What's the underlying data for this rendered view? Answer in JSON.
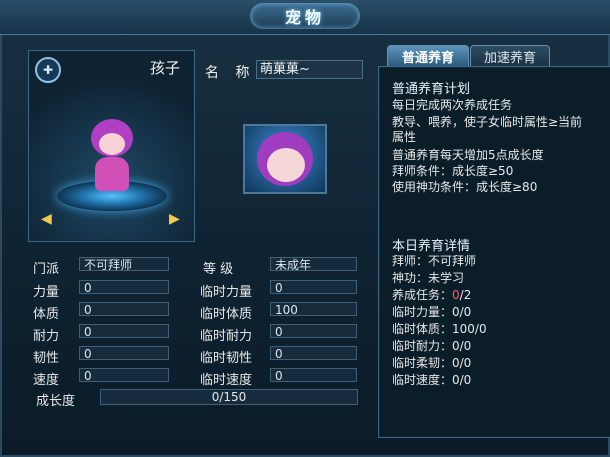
{
  "window": {
    "title": "宠物"
  },
  "pet": {
    "panel_label": "孩子",
    "name_label": "名 称",
    "name_value": "萌菓菓~"
  },
  "stats": {
    "sect_label": "门派",
    "sect_value": "不可拜师",
    "level_label": "等 级",
    "level_value": "未成年",
    "strength_label": "力量",
    "strength_value": "0",
    "temp_strength_label": "临时力量",
    "temp_strength_value": "0",
    "physique_label": "体质",
    "physique_value": "0",
    "temp_physique_label": "临时体质",
    "temp_physique_value": "100",
    "endurance_label": "耐力",
    "endurance_value": "0",
    "temp_endurance_label": "临时耐力",
    "temp_endurance_value": "0",
    "toughness_label": "韧性",
    "toughness_value": "0",
    "temp_toughness_label": "临时韧性",
    "temp_toughness_value": "0",
    "speed_label": "速度",
    "speed_value": "0",
    "temp_speed_label": "临时速度",
    "temp_speed_value": "0",
    "growth_label": "成长度",
    "growth_value": "0/150",
    "growth_progress": 0
  },
  "tabs": {
    "normal": "普通养育",
    "advanced": "加速养育"
  },
  "plan": {
    "title": "普通养育计划",
    "line1": "每日完成两次养成任务",
    "line2": "教导、喂养，使子女临时属性≥当前",
    "line3": "属性",
    "line4": "普通养育每天增加5点成长度",
    "line5": "拜师条件：成长度≥50",
    "line6": "使用神功条件：成长度≥80"
  },
  "details": {
    "title": "本日养育详情",
    "master": "拜师：不可拜师",
    "skill": "神功：未学习",
    "task_prefix": "养成任务：",
    "task_done": "0",
    "task_total": "/2",
    "temp_strength": "临时力量：0/0",
    "temp_physique": "临时体质：100/0",
    "temp_endurance": "临时耐力：0/0",
    "temp_agility": "临时柔韧：0/0",
    "temp_speed": "临时速度：0/0"
  },
  "colors": {
    "accent": "#2f7cb8",
    "highlight": "#ff5a5a"
  }
}
